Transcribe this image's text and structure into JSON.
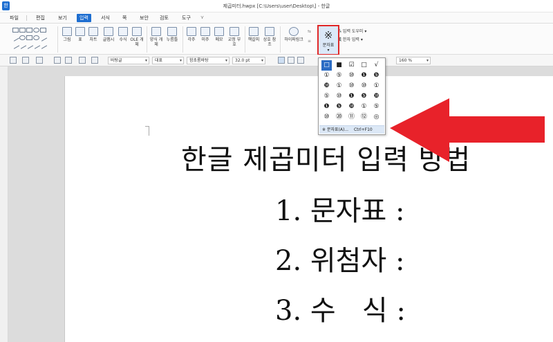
{
  "window": {
    "title": "제곱미터.hwpx [C:\\Users\\user\\Desktop\\] - 한글",
    "app_icon_label": "한"
  },
  "menu": {
    "items": [
      "파일",
      "편집",
      "보기",
      "입력",
      "서식",
      "쪽",
      "보안",
      "검토",
      "도구"
    ],
    "active": "입력"
  },
  "ribbon": {
    "buttons": [
      {
        "label": "그림"
      },
      {
        "label": "표"
      },
      {
        "label": "차트"
      },
      {
        "label": "글맵시"
      },
      {
        "label": "수식"
      },
      {
        "label": "OLE 개체"
      },
      {
        "label": "양식 개체"
      },
      {
        "label": "누름틀"
      },
      {
        "label": "각주"
      },
      {
        "label": "미주"
      },
      {
        "label": "메모"
      },
      {
        "label": "교정 부호"
      },
      {
        "label": "책갈피"
      },
      {
        "label": "상호 참조"
      },
      {
        "label": "하이퍼링크"
      }
    ],
    "charmap": {
      "label": "문자표",
      "symbol": "※"
    },
    "input_helper": "입력 도우미",
    "hanja_input": "한자 입력"
  },
  "format_toolbar": {
    "style": "바탕글",
    "lang": "대표",
    "font": "함초롬바탕",
    "size": "32.0",
    "unit": "pt",
    "zoom": "160",
    "zoom_unit": "%"
  },
  "dropdown": {
    "rows": [
      [
        "□",
        "■",
        "☑",
        "□",
        "√"
      ],
      [
        "①",
        "⑤",
        "⑩",
        "❶",
        "❺"
      ],
      [
        "❿",
        "①",
        "⑩",
        "⑩",
        "①"
      ],
      [
        "⑤",
        "⑩",
        "❶",
        "❺",
        "❿"
      ],
      [
        "❶",
        "❺",
        "❿",
        "①",
        "⑤"
      ],
      [
        "⑩",
        "⑳",
        "⑪",
        "⑫",
        "◎"
      ]
    ],
    "footer_label": "문자표(A)...",
    "footer_shortcut": "Ctrl+F10",
    "footer_icon": "※"
  },
  "document": {
    "title": "한글 제곱미터 입력 방법",
    "lines": [
      "1. 문자표 :",
      "2. 위첨자 :",
      "3. 수   식 :"
    ]
  },
  "colors": {
    "accent": "#1e6ed0",
    "highlight_red": "#e02828",
    "arrow_red": "#e8222a"
  }
}
